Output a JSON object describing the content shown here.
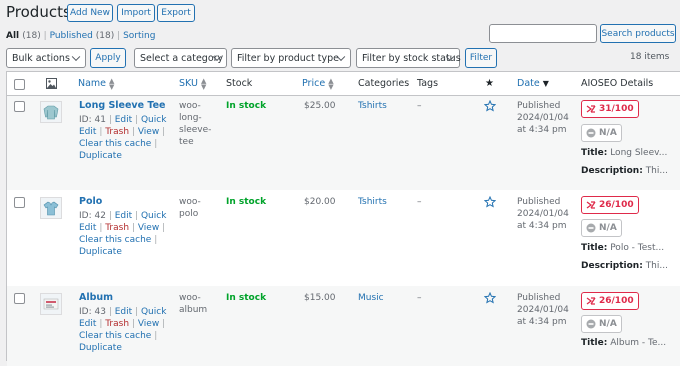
{
  "header": {
    "title": "Products",
    "add_new": "Add New",
    "import": "Import",
    "export": "Export"
  },
  "views": {
    "all": "All",
    "all_count": "(18)",
    "sep": "|",
    "published": "Published",
    "published_count": "(18)",
    "sorting": "Sorting"
  },
  "search": {
    "placeholder": "",
    "button": "Search products"
  },
  "filters": {
    "bulk_actions": "Bulk actions",
    "apply": "Apply",
    "category": "Select a category",
    "product_type": "Filter by product type",
    "stock_status": "Filter by stock status",
    "filter": "Filter",
    "items_count": "18 items"
  },
  "columns": {
    "name": "Name",
    "sku": "SKU",
    "stock": "Stock",
    "price": "Price",
    "categories": "Categories",
    "tags": "Tags",
    "featured_glyph": "★",
    "date": "Date",
    "aioseo": "AIOSEO Details"
  },
  "row_actions": {
    "edit": "Edit",
    "quick_edit": "Quick Edit",
    "trash": "Trash",
    "view": "View",
    "clear_cache": "Clear this cache",
    "duplicate": "Duplicate",
    "sep": "|"
  },
  "rows": [
    {
      "name": "Long Sleeve Tee",
      "id": "ID: 41",
      "sku_lines": [
        "woo-",
        "long-",
        "sleeve-",
        "tee"
      ],
      "stock": "In stock",
      "price": "$25.00",
      "category": "Tshirts",
      "tags": "–",
      "date_status": "Published",
      "date": "2024/01/04",
      "time": "at 4:34 pm",
      "score": "31/100",
      "na": "N/A",
      "title_label": "Title:",
      "title_value": "Long Sleev...",
      "desc_label": "Description:",
      "desc_value": "Thi..."
    },
    {
      "name": "Polo",
      "id": "ID: 42",
      "sku_lines": [
        "woo-",
        "polo"
      ],
      "stock": "In stock",
      "price": "$20.00",
      "category": "Tshirts",
      "tags": "–",
      "date_status": "Published",
      "date": "2024/01/04",
      "time": "at 4:34 pm",
      "score": "26/100",
      "na": "N/A",
      "title_label": "Title:",
      "title_value": "Polo - Test...",
      "desc_label": "Description:",
      "desc_value": "Thi..."
    },
    {
      "name": "Album",
      "id": "ID: 43",
      "sku_lines": [
        "woo-",
        "album"
      ],
      "stock": "In stock",
      "price": "$15.00",
      "category": "Music",
      "tags": "–",
      "date_status": "Published",
      "date": "2024/01/04",
      "time": "at 4:34 pm",
      "score": "26/100",
      "na": "N/A",
      "title_label": "Title:",
      "title_value": "Album - Te..."
    }
  ],
  "colors": {
    "link": "#2271b1",
    "stock": "#00a32a",
    "trash": "#b32d2e",
    "seo_bad": "#df2a4a",
    "background": "#f0f0f1"
  }
}
